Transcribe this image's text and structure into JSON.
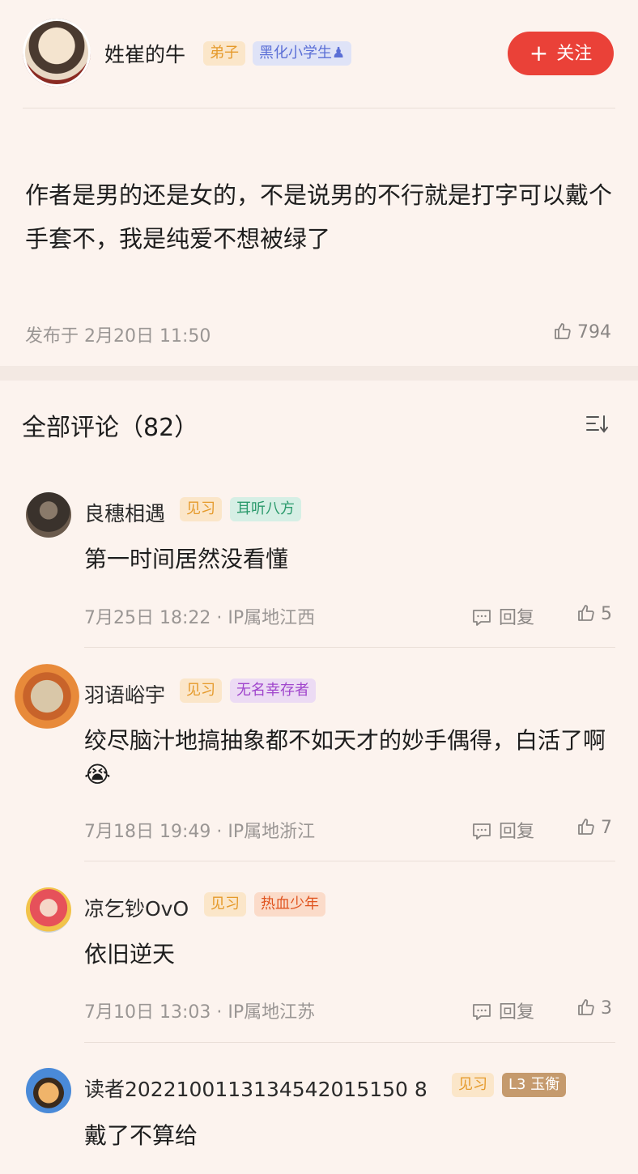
{
  "post": {
    "author": {
      "name": "姓崔的牛",
      "badges": [
        "弟子",
        "黑化小学生♟"
      ]
    },
    "follow_label": "关注",
    "follow_plus": "+",
    "body": "作者是男的还是女的，不是说男的不行就是打字可以戴个手套不，我是纯爱不想被绿了",
    "published": "发布于 2月20日 11:50",
    "likes": "794"
  },
  "comments_section": {
    "title": "全部评论（82）",
    "sort_icon": "sort-icon"
  },
  "comments": [
    {
      "name": "良穗相遇",
      "badges": [
        "见习",
        "耳听八方"
      ],
      "text": "第一时间居然没看懂",
      "meta": "7月25日 18:22 · IP属地江西",
      "reply_label": "回复",
      "likes": "5"
    },
    {
      "name": "羽语峪宇",
      "badges": [
        "见习",
        "无名幸存者"
      ],
      "text": "绞尽脑汁地搞抽象都不如天才的妙手偶得，白活了啊",
      "emoji": "😭",
      "meta": "7月18日 19:49 · IP属地浙江",
      "reply_label": "回复",
      "likes": "7"
    },
    {
      "name": "凉乞钞OvO",
      "badges": [
        "见习",
        "热血少年"
      ],
      "text": "依旧逆天",
      "meta": "7月10日 13:03 · IP属地江苏",
      "reply_label": "回复",
      "likes": "3"
    },
    {
      "name": "读者2022100113134542015150 8",
      "badges": [
        "见习",
        "L3 玉衡"
      ],
      "text": "戴了不算给"
    }
  ],
  "colors": {
    "background": "#fcf3ee",
    "accent": "#ea4138"
  }
}
